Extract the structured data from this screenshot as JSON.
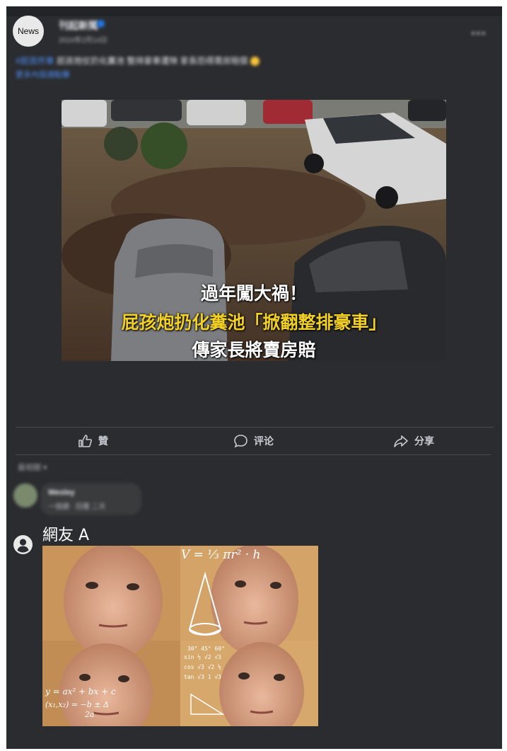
{
  "post": {
    "avatar_label": "News",
    "page_name": "刊起新聞",
    "timestamp": "2024年2月14日",
    "caption_tag": "#屁孩炸車",
    "caption_text": "屁孩炮仗扔化糞池 整排豪車遭殃 家長恐得賣房賠償",
    "caption_link": "更多內容請點擊",
    "more_icon": "more-horizontal-icon",
    "image_overlay": {
      "line1": "過年闖大禍！",
      "line2": "屁孩炮扔化糞池「掀翻整排豪車」",
      "line3": "傳家長將賣房賠"
    }
  },
  "actions": {
    "like_label": "贊",
    "comment_label": "评论",
    "share_label": "分享"
  },
  "comments": {
    "sort_label": "最相關",
    "blurred_name": "Wesley",
    "blurred_text": "一個讚 · 回覆 二天",
    "reply_user": "網友 A"
  },
  "colors": {
    "frame_bg": "#2b2c2f",
    "text_primary": "#e4e6eb",
    "link_blue": "#4d8ff5",
    "overlay_yellow": "#f2d024"
  }
}
